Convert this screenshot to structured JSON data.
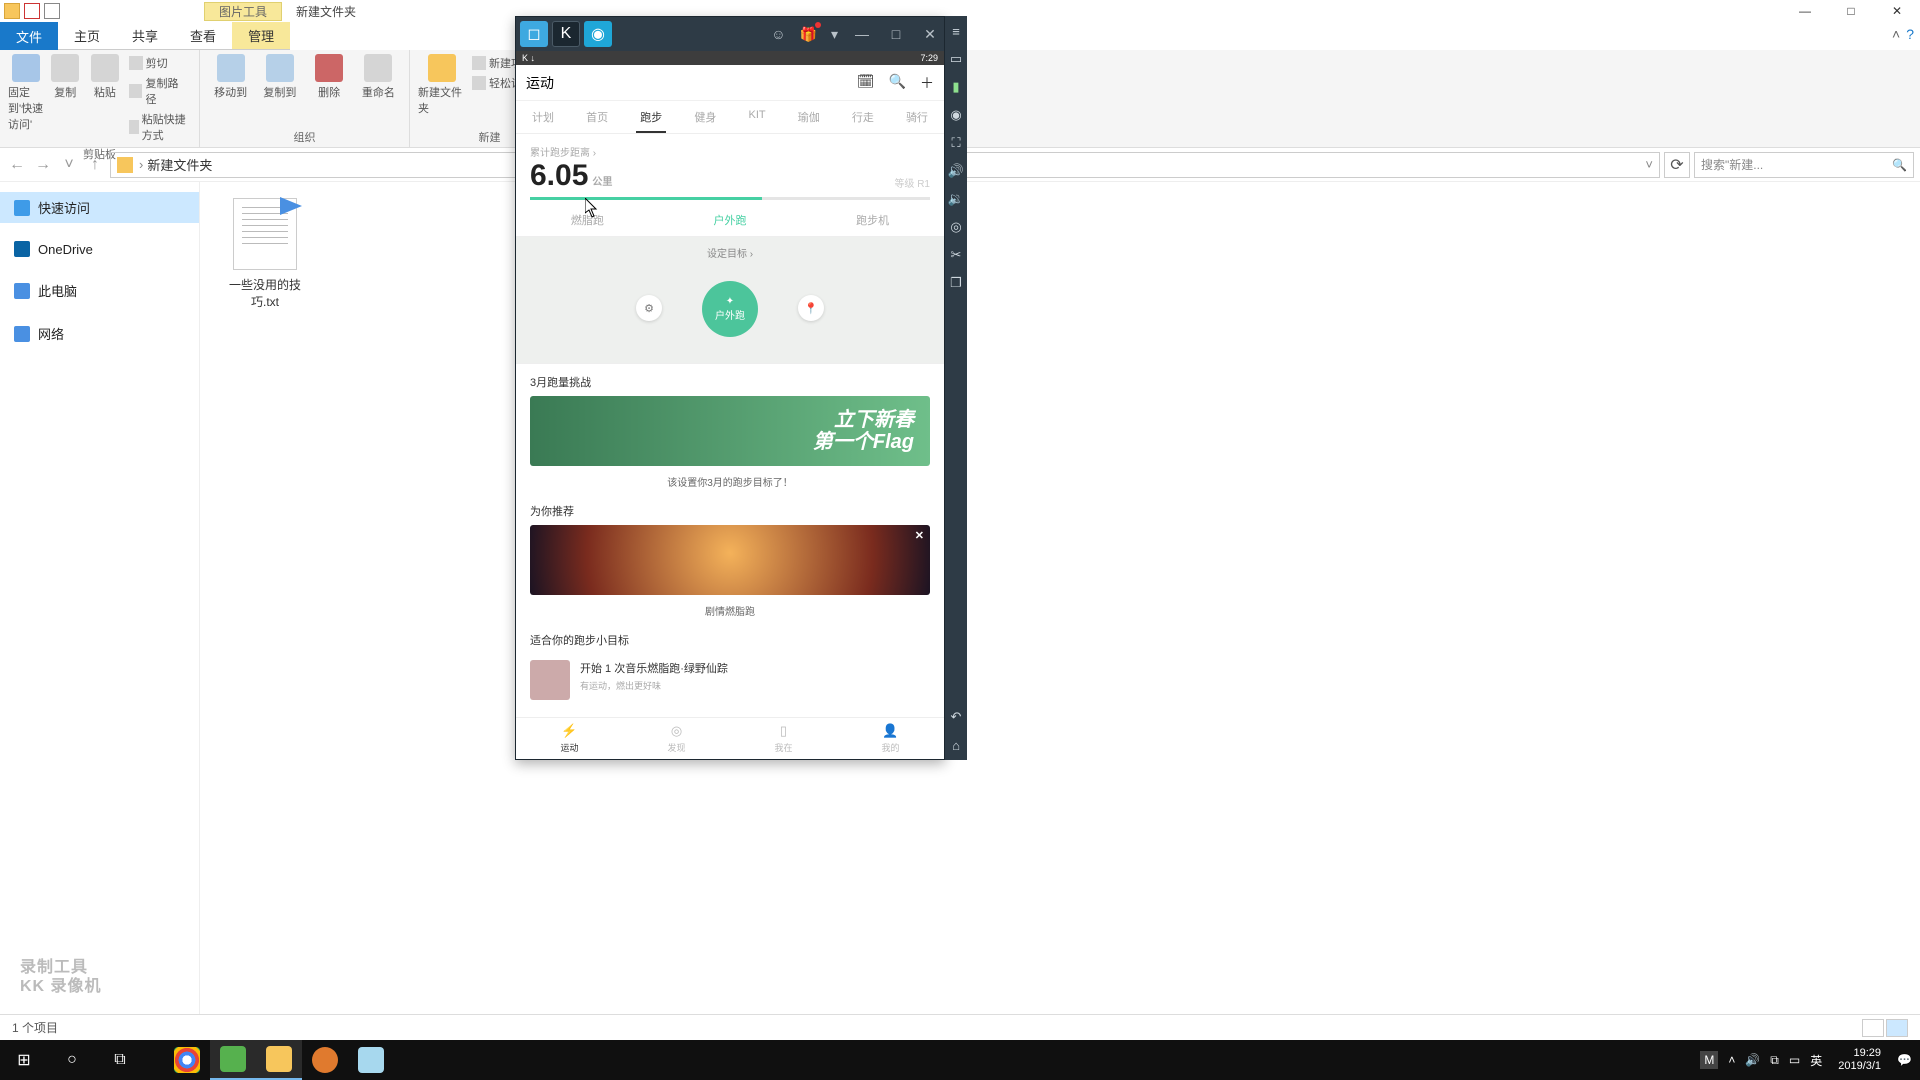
{
  "explorer": {
    "picture_tools_tab": "图片工具",
    "title_folder": "新建文件夹",
    "ribbon_tabs": {
      "file": "文件",
      "home": "主页",
      "share": "共享",
      "view": "查看",
      "manage": "管理"
    },
    "clipboard": {
      "pin": "固定到'快速访问'",
      "copy": "复制",
      "paste": "粘贴",
      "cut": "剪切",
      "copy_path": "复制路径",
      "paste_shortcut": "粘贴快捷方式",
      "group": "剪贴板"
    },
    "organize": {
      "move_to": "移动到",
      "copy_to": "复制到",
      "delete": "删除",
      "rename": "重命名",
      "group": "组织"
    },
    "new": {
      "new_folder": "新建文件夹",
      "new_item": "新建项目",
      "easy_access": "轻松访问",
      "group": "新建"
    },
    "address": {
      "crumb1": "新建文件夹"
    },
    "search_placeholder": "搜索\"新建...",
    "nav": {
      "quick_access": "快速访问",
      "onedrive": "OneDrive",
      "this_pc": "此电脑",
      "network": "网络"
    },
    "file1": "一些没用的技巧.txt",
    "status": "1 个项目"
  },
  "watermark": {
    "l1": "录制工具",
    "l2": "KK 录像机"
  },
  "emulator": {
    "title_right_icons": [
      "user-icon",
      "gift-icon",
      "download-icon"
    ],
    "phone": {
      "status_time": "7:29",
      "header_title": "运动",
      "tabs": [
        "计划",
        "首页",
        "跑步",
        "健身",
        "KIT",
        "瑜伽",
        "行走",
        "骑行"
      ],
      "active_tab_index": 2,
      "distance_label": "累计跑步距离",
      "distance_value": "6.05",
      "distance_unit": "公里",
      "grade": "等级 R1",
      "modes": [
        "燃脂跑",
        "户外跑",
        "跑步机"
      ],
      "active_mode_index": 1,
      "set_goal": "设定目标",
      "start_label": "户外跑",
      "section_march": "3月跑量挑战",
      "banner1_l1": "立下新春",
      "banner1_l2": "第一个Flag",
      "banner1_sub": "该设置你3月的跑步目标了！",
      "section_rec": "为你推荐",
      "banner2_title": "剧情燃脂跑",
      "section_mini": "适合你的跑步小目标",
      "mini_title": "开始 1 次音乐燃脂跑·绿野仙踪",
      "mini_sub": "有运动，燃出更好味",
      "bottom": [
        "运动",
        "发现",
        "我在",
        "我的"
      ]
    }
  },
  "taskbar": {
    "lang": "英",
    "time": "19:29",
    "date": "2019/3/1"
  }
}
